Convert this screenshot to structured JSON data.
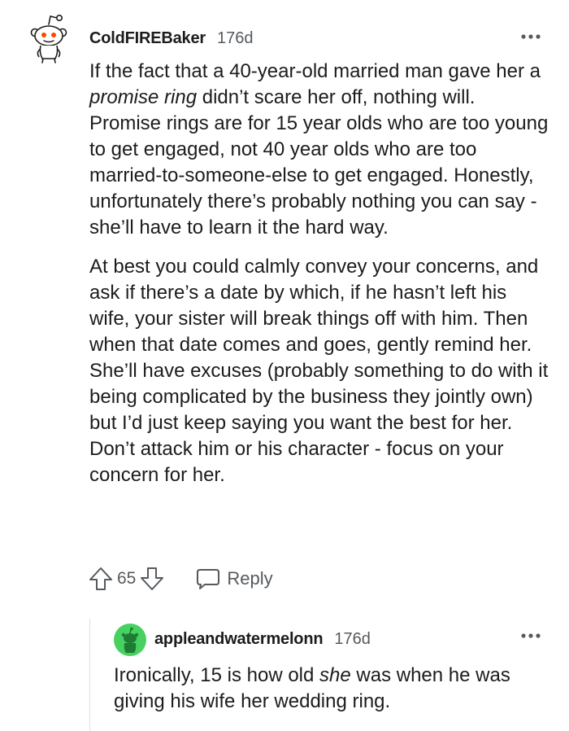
{
  "top_comment": {
    "username": "ColdFIREBaker",
    "age": "176d",
    "avatar_icon": "snoo-avatar-icon",
    "paragraph_1": {
      "before": "If the fact that a 40-year-old married man gave her a ",
      "emphasis": "promise ring",
      "after": " didn’t scare her off, nothing will. Promise rings are for 15 year olds who are too young to get engaged, not 40 year olds who are too married-to-someone-else to get engaged. Honestly, unfortunately there’s probably nothing you can say - she’ll have to learn it the hard way."
    },
    "paragraph_2": "At best you could calmly convey your concerns, and ask if there’s a date by which, if he hasn’t left his wife, your sister will break things off with him. Then when that date comes and goes, gently remind her. She’ll have excuses (probably something to do with it being complicated by the business they jointly own) but I’d just keep saying you want the best for her. Don’t attack him or his character - focus on your concern for her.",
    "score": "65",
    "reply_label": "Reply",
    "icons": {
      "upvote": "upvote-arrow-icon",
      "downvote": "downvote-arrow-icon",
      "reply": "speech-bubble-icon",
      "more": "more-dots-icon"
    }
  },
  "reply_comment": {
    "username": "appleandwatermelonn",
    "age": "176d",
    "avatar_icon": "green-snoo-avatar-icon",
    "avatar_color": "#46d160",
    "text": {
      "before": "Ironically, 15 is how old ",
      "emphasis": "she",
      "after": " was when he was giving his wife her wedding ring."
    }
  },
  "colors": {
    "text_primary": "#1c1c1c",
    "text_meta": "#555a5e",
    "snoo_red": "#ff4500",
    "thread_line": "#e0e0e0"
  }
}
